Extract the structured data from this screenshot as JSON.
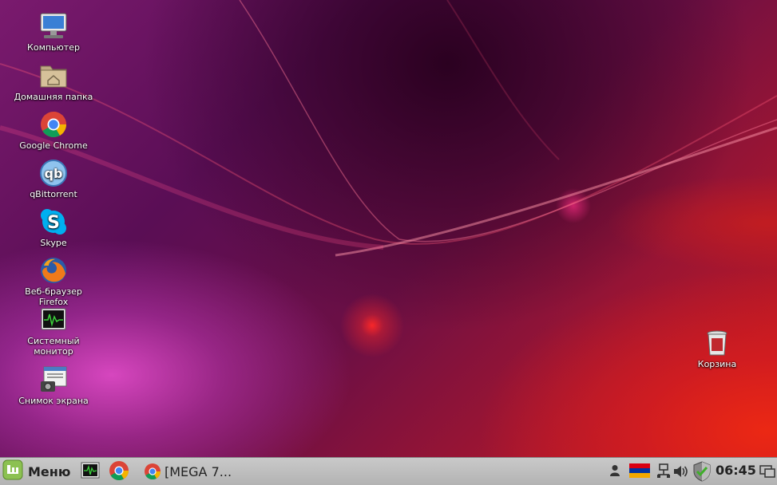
{
  "desktop": {
    "icons": [
      {
        "label": "Компьютер",
        "icon": "computer-icon"
      },
      {
        "label": "Домашняя папка",
        "icon": "home-folder-icon"
      },
      {
        "label": "Google Chrome",
        "icon": "chrome-icon"
      },
      {
        "label": "qBittorrent",
        "icon": "qbittorrent-icon"
      },
      {
        "label": "Skype",
        "icon": "skype-icon"
      },
      {
        "label": "Веб-браузер Firefox",
        "icon": "firefox-icon"
      },
      {
        "label": "Системный\nмонитор",
        "line1": "Системный",
        "line2": "монитор",
        "icon": "system-monitor-icon"
      },
      {
        "label": "Снимок экрана",
        "icon": "screenshot-icon"
      }
    ],
    "trash": {
      "label": "Корзина",
      "icon": "trash-icon"
    }
  },
  "panel": {
    "menu_label": "Меню",
    "task_label": "[MEGA 7...",
    "clock": "06:45",
    "tray": [
      "user-icon",
      "keyboard-layout-flag-icon",
      "network-icon",
      "volume-icon",
      "shield-update-icon",
      "show-desktop-icon"
    ]
  },
  "colors": {
    "panel": "#bdbdbd",
    "mint_green": "#8cc152",
    "text": "#222222"
  }
}
